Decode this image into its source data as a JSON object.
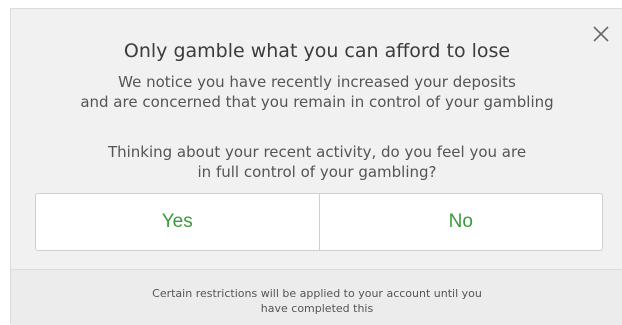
{
  "dialog": {
    "title": "Only gamble what you can afford to lose",
    "message_1": {
      "line_1": "We notice you have recently increased your deposits",
      "line_2": "and are concerned that you remain in control of your gambling"
    },
    "message_2": {
      "line_1": "Thinking about your recent activity, do you feel you are",
      "line_2": "in full control of your gambling?"
    },
    "buttons": {
      "yes_label": "Yes",
      "no_label": "No"
    },
    "footer": {
      "line_1": "Certain restrictions will be applied to your account until you",
      "line_2": "have completed this"
    },
    "close_icon": "close-icon"
  },
  "colors": {
    "dialog_background": "#f1f1f1",
    "button_text": "#3a9a3a",
    "title_text": "#3c3c3c",
    "body_text": "#555555"
  }
}
